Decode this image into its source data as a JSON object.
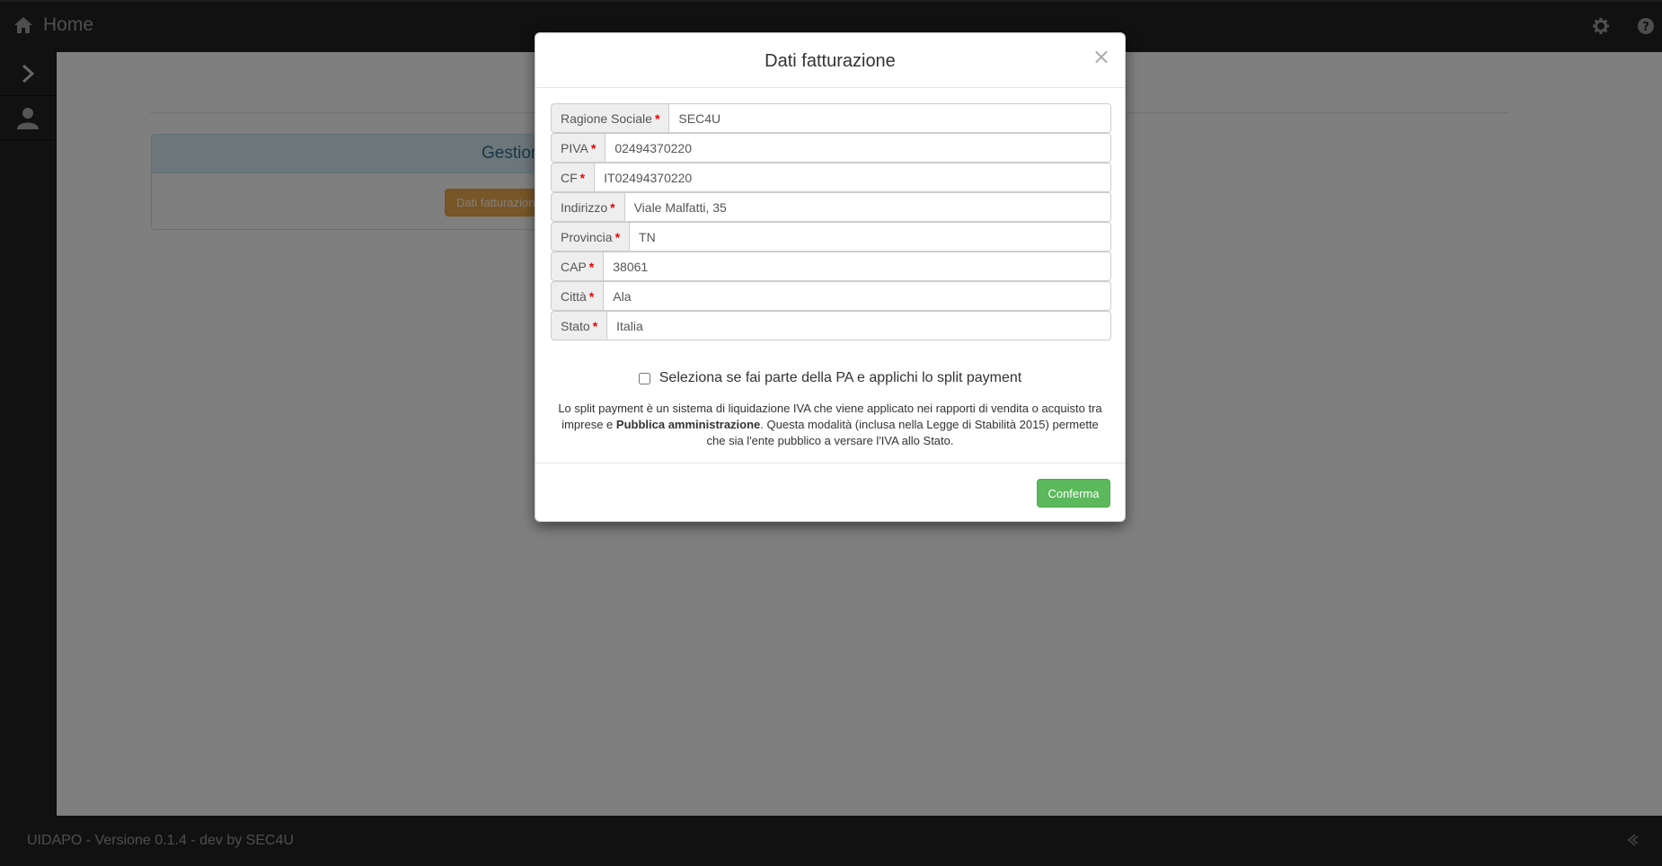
{
  "navbar": {
    "brand_label": "Home",
    "home_icon": "home-icon",
    "settings_icon": "gear-icon",
    "help_icon": "question-circle-icon"
  },
  "sidebar": {
    "items": [
      {
        "icon": "chevron-right-icon"
      },
      {
        "icon": "user-icon"
      }
    ]
  },
  "main": {
    "panel_title": "Gestione licenze",
    "warning_button_label": "Dati fatturazione non conf"
  },
  "footer": {
    "text": "UIDAPO - Versione 0.1.4 - dev by SEC4U",
    "icon": "collapse-icon"
  },
  "modal": {
    "title": "Dati fatturazione",
    "close_label": "×",
    "fields": [
      {
        "label": "Ragione Sociale",
        "value": "SEC4U"
      },
      {
        "label": "PIVA",
        "value": "02494370220"
      },
      {
        "label": "CF",
        "value": "IT02494370220"
      },
      {
        "label": "Indirizzo",
        "value": "Viale Malfatti, 35"
      },
      {
        "label": "Provincia",
        "value": "TN"
      },
      {
        "label": "CAP",
        "value": "38061"
      },
      {
        "label": "Città",
        "value": "Ala"
      },
      {
        "label": "Stato",
        "value": "Italia"
      }
    ],
    "required_mark": "*",
    "split_payment_label": "Seleziona se fai parte della PA e applichi lo split payment",
    "note_part1": "Lo split payment è un sistema di liquidazione IVA che viene applicato nei rapporti di vendita o acquisto tra imprese e ",
    "note_bold": "Pubblica amministrazione",
    "note_part2": ". Questa modalità (inclusa nella Legge di Stabilità 2015) permette che sia l'ente pubblico a versare l'IVA allo Stato.",
    "confirm_label": "Conferma"
  },
  "colors": {
    "navbar_bg": "#222222",
    "panel_heading_bg": "#d9edf7",
    "warning": "#f0ad4e",
    "success": "#5cb85c"
  }
}
